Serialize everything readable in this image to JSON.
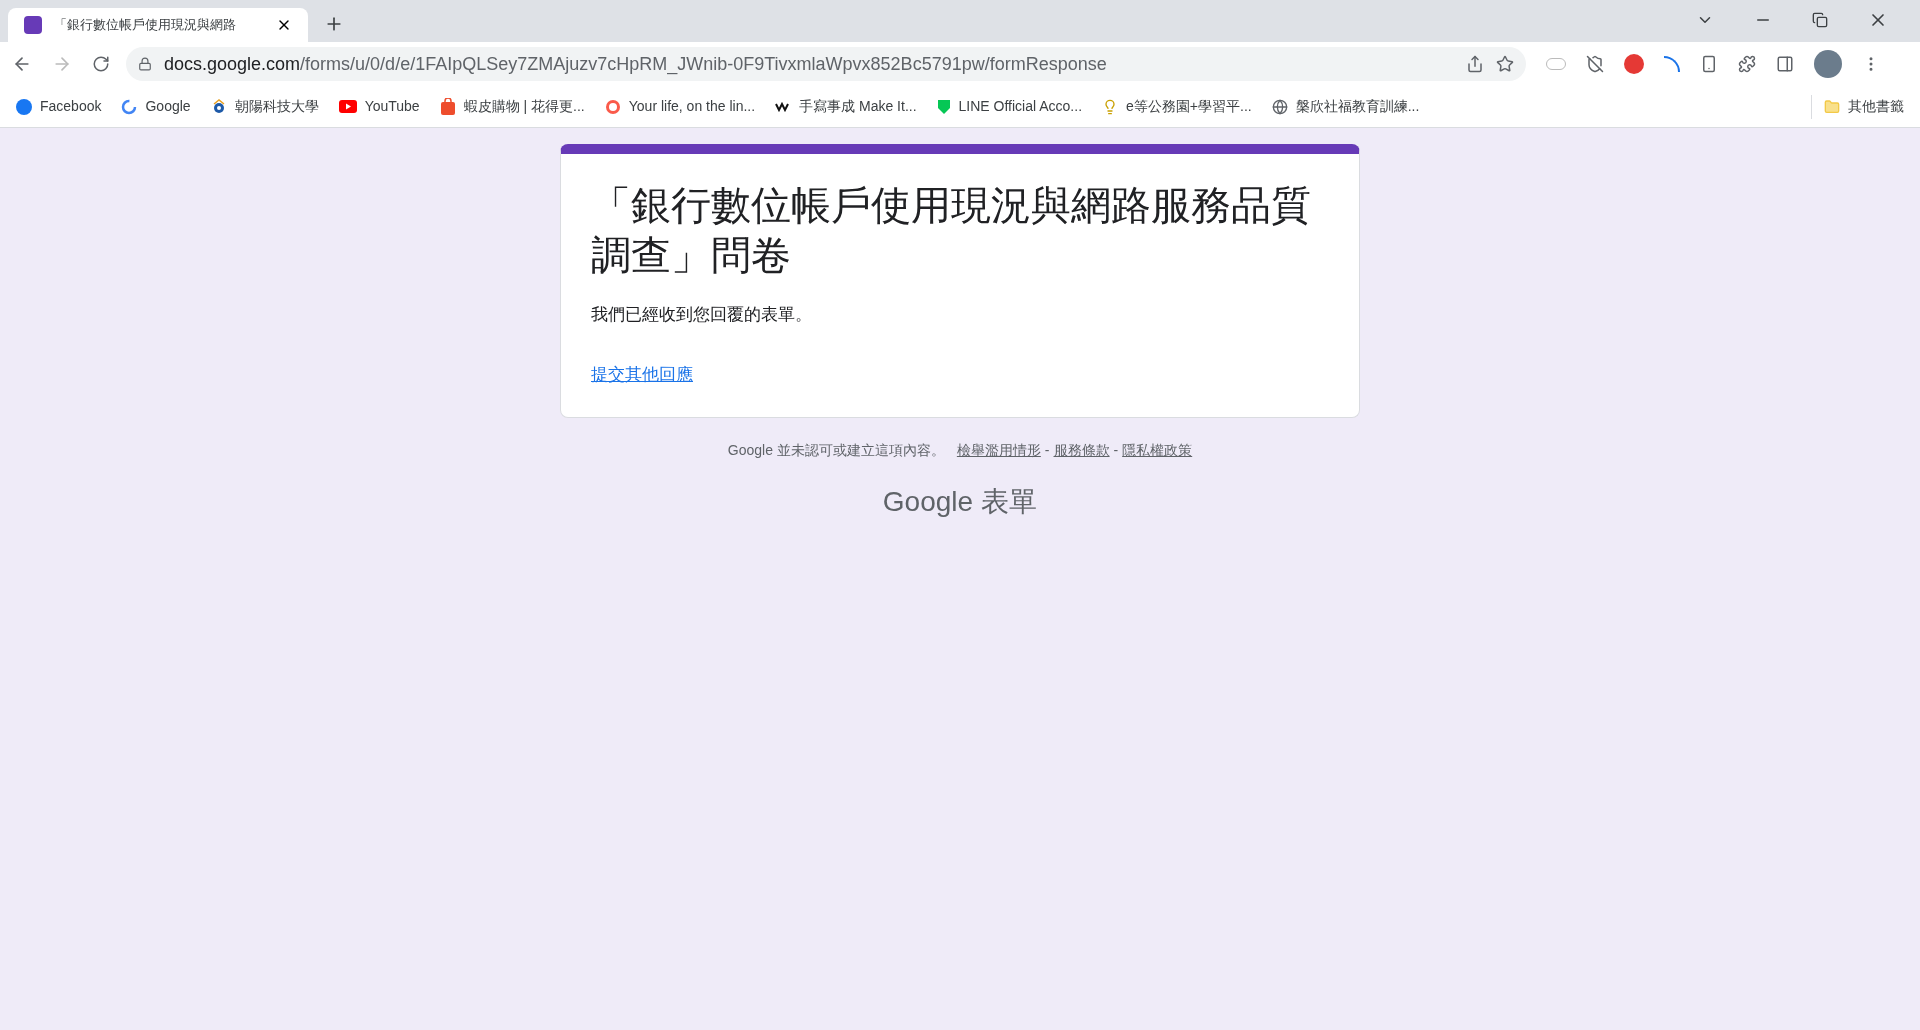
{
  "tabs": [
    {
      "title": "「銀行數位帳戶使用現況與網路",
      "selected": true
    }
  ],
  "address_bar": {
    "host": "docs.google.com",
    "path": "/forms/u/0/d/e/1FAIpQLSey7ZMAjuzv7cHpRM_JWnib-0F9TivxmlaWpvx852Bc5791pw/formResponse"
  },
  "bookmarks": [
    {
      "label": "Facebook",
      "kind": "facebook"
    },
    {
      "label": "Google",
      "kind": "google"
    },
    {
      "label": "朝陽科技大學",
      "kind": "school"
    },
    {
      "label": "YouTube",
      "kind": "youtube"
    },
    {
      "label": "蝦皮購物 | 花得更...",
      "kind": "shop"
    },
    {
      "label": "Your life, on the lin...",
      "kind": "life"
    },
    {
      "label": "手寫事成 Make It...",
      "kind": "write"
    },
    {
      "label": "LINE Official Acco...",
      "kind": "line"
    },
    {
      "label": "e等公務園+學習平...",
      "kind": "bulb"
    },
    {
      "label": "槃欣社福教育訓練...",
      "kind": "globe"
    }
  ],
  "other_bookmarks": "其他書籤",
  "form": {
    "title": "「銀行數位帳戶使用現況與網路服務品質調查」問卷",
    "message": "我們已經收到您回覆的表單。",
    "link": "提交其他回應"
  },
  "footer": {
    "notice": "Google 並未認可或建立這項內容。",
    "links": [
      "檢舉濫用情形",
      "服務條款",
      "隱私權政策"
    ],
    "separator": "-",
    "logo": "Google",
    "logo_suffix": "表單"
  }
}
